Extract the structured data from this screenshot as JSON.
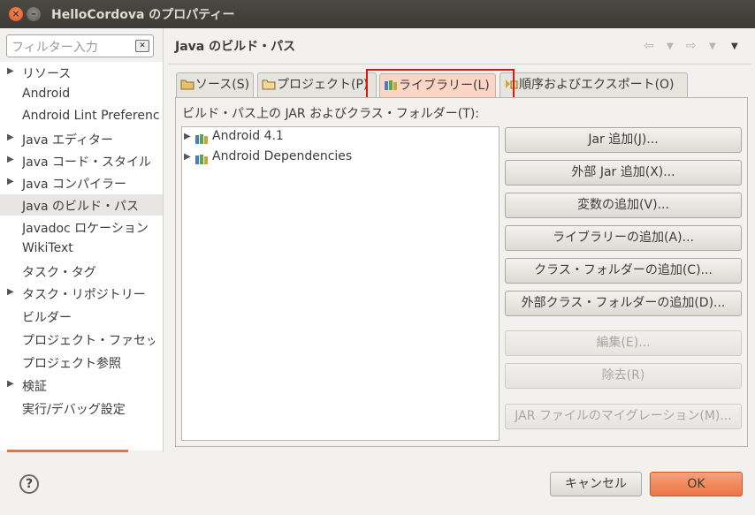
{
  "window": {
    "title": "HelloCordova のプロパティー"
  },
  "filter": {
    "placeholder": "フィルター入力"
  },
  "sidebar": {
    "items": [
      {
        "label": "リソース",
        "expandable": true
      },
      {
        "label": "Android",
        "expandable": false
      },
      {
        "label": "Android Lint Preferences",
        "expandable": false
      },
      {
        "label": "Java エディター",
        "expandable": true
      },
      {
        "label": "Java コード・スタイル",
        "expandable": true
      },
      {
        "label": "Java コンパイラー",
        "expandable": true
      },
      {
        "label": "Java のビルド・パス",
        "expandable": false,
        "selected": true
      },
      {
        "label": "Javadoc ロケーション",
        "expandable": false
      },
      {
        "label": "WikiText",
        "expandable": false
      },
      {
        "label": "タスク・タグ",
        "expandable": false
      },
      {
        "label": "タスク・リポジトリー",
        "expandable": true
      },
      {
        "label": "ビルダー",
        "expandable": false
      },
      {
        "label": "プロジェクト・ファセット",
        "expandable": false
      },
      {
        "label": "プロジェクト参照",
        "expandable": false
      },
      {
        "label": "検証",
        "expandable": true
      },
      {
        "label": "実行/デバッグ設定",
        "expandable": false
      }
    ]
  },
  "page": {
    "title": "Java のビルド・パス"
  },
  "tabs": [
    {
      "label": "ソース(S)",
      "icon": "source-folder-icon"
    },
    {
      "label": "プロジェクト(P)",
      "icon": "project-folder-icon"
    },
    {
      "label": "ライブラリー(L)",
      "icon": "library-icon",
      "active": true
    },
    {
      "label": "順序およびエクスポート(O)",
      "icon": "order-export-icon"
    }
  ],
  "libraries_panel": {
    "label": "ビルド・パス上の JAR およびクラス・フォルダー(T):",
    "items": [
      "Android 4.1",
      "Android Dependencies"
    ]
  },
  "buttons": {
    "add_jar": "Jar 追加(J)...",
    "add_external_jar": "外部 Jar 追加(X)...",
    "add_variable": "変数の追加(V)...",
    "add_library": "ライブラリーの追加(A)...",
    "add_class_folder": "クラス・フォルダーの追加(C)...",
    "add_external_class_folder": "外部クラス・フォルダーの追加(D)...",
    "edit": "編集(E)...",
    "remove": "除去(R)",
    "migrate_jar": "JAR ファイルのマイグレーション(M)..."
  },
  "footer": {
    "cancel": "キャンセル",
    "ok": "OK"
  },
  "colors": {
    "accent": "#ec7644",
    "highlight": "#e1170c"
  }
}
